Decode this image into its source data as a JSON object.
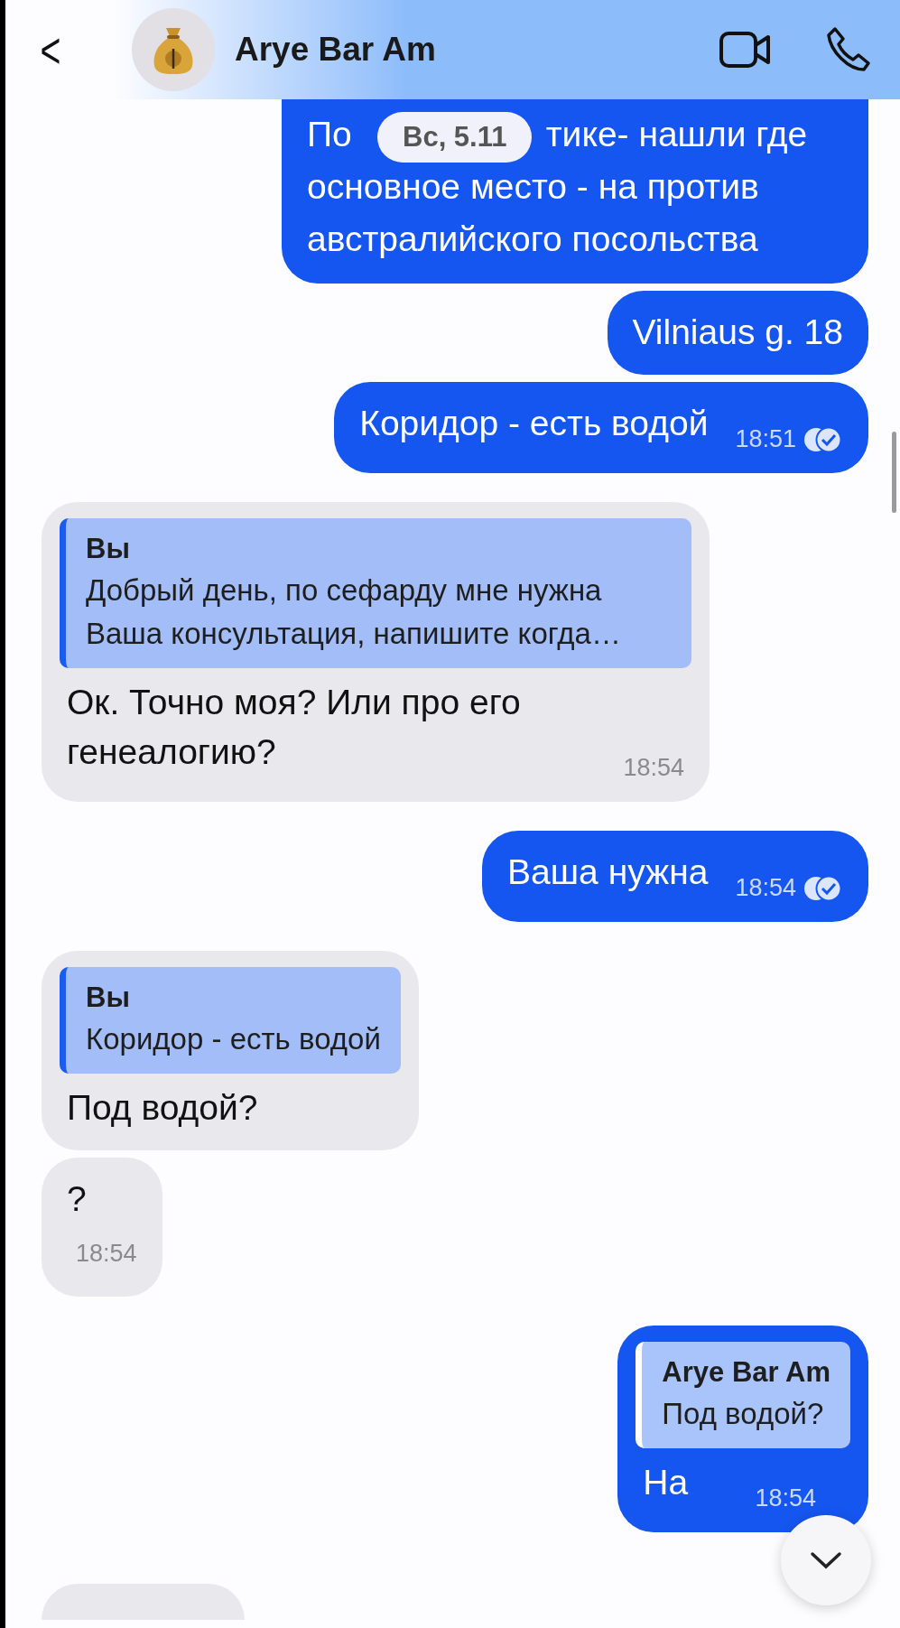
{
  "header": {
    "back": "<",
    "contact_name": "Arye Bar Am"
  },
  "date_chip": {
    "label": "Вс, 5.11"
  },
  "messages": [
    {
      "kind": "outgoing",
      "covered_line": [
        "По",
        "тике- нашли где"
      ],
      "text": "основное место - на против австралийского посольства"
    },
    {
      "kind": "outgoing",
      "text": "Vilniaus g. 18"
    },
    {
      "kind": "outgoing",
      "text": "Коридор - есть водой",
      "time": "18:51",
      "read": true
    },
    {
      "kind": "incoming",
      "reply": {
        "author": "Вы",
        "text": "Добрый день, по сефарду мне нужна Ваша консультация, напишите когда…"
      },
      "text": "Ок. Точно моя? Или про его генеалогию?",
      "time": "18:54"
    },
    {
      "kind": "outgoing",
      "text": "Ваша нужна",
      "time": "18:54",
      "read": true
    },
    {
      "kind": "incoming",
      "reply": {
        "author": "Вы",
        "text": "Коридор - есть водой"
      },
      "text": "Под водой?"
    },
    {
      "kind": "incoming",
      "text": "?",
      "time": "18:54"
    },
    {
      "kind": "outgoing",
      "reply": {
        "author": "Arye Bar Am",
        "text": "Под водой?"
      },
      "text": "На",
      "time": "18:54",
      "read": false
    },
    {
      "kind": "incoming"
    }
  ]
}
